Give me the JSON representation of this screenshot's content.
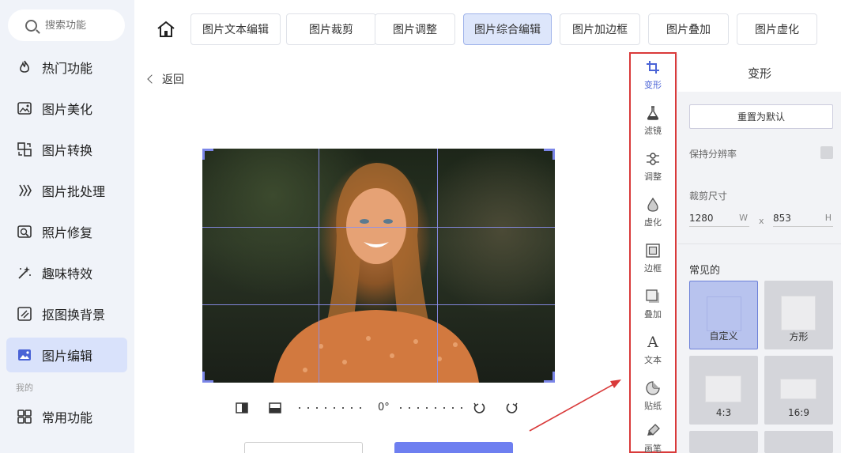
{
  "search": {
    "placeholder": "搜索功能",
    "icon": "search-icon"
  },
  "sidebar": {
    "items": [
      {
        "label": "热门功能",
        "icon": "fire-icon"
      },
      {
        "label": "图片美化",
        "icon": "image-beautify-icon"
      },
      {
        "label": "图片转换",
        "icon": "convert-icon"
      },
      {
        "label": "图片批处理",
        "icon": "batch-icon"
      },
      {
        "label": "照片修复",
        "icon": "repair-icon"
      },
      {
        "label": "趣味特效",
        "icon": "magic-wand-icon"
      },
      {
        "label": "抠图换背景",
        "icon": "cutout-icon"
      },
      {
        "label": "图片编辑",
        "icon": "image-edit-icon",
        "active": true
      }
    ],
    "section_label": "我的",
    "my_items": [
      {
        "label": "常用功能",
        "icon": "grid-icon"
      }
    ]
  },
  "topbar": {
    "home_icon": "home-icon",
    "tabs": [
      {
        "label": "图片文本编辑"
      },
      {
        "label": "图片裁剪"
      },
      {
        "label": "图片调整"
      },
      {
        "label": "图片综合编辑",
        "active": true
      },
      {
        "label": "图片加边框"
      },
      {
        "label": "图片叠加"
      },
      {
        "label": "图片虚化"
      }
    ]
  },
  "main": {
    "back_label": "返回",
    "rotation_label": "0°"
  },
  "rail": {
    "items": [
      {
        "label": "变形",
        "icon": "crop-icon",
        "active": true
      },
      {
        "label": "滤镜",
        "icon": "flask-icon"
      },
      {
        "label": "调整",
        "icon": "adjust-icon"
      },
      {
        "label": "虚化",
        "icon": "drop-icon"
      },
      {
        "label": "边框",
        "icon": "frame-icon"
      },
      {
        "label": "叠加",
        "icon": "overlay-icon"
      },
      {
        "label": "文本",
        "icon": "text-icon"
      },
      {
        "label": "贴纸",
        "icon": "sticker-icon"
      },
      {
        "label": "画笔",
        "icon": "brush-icon"
      }
    ]
  },
  "panel": {
    "title": "变形",
    "reset_label": "重置为默认",
    "keep_resolution_label": "保持分辨率",
    "crop_size_label": "裁剪尺寸",
    "width_value": "1280",
    "width_unit": "W",
    "times": "x",
    "height_value": "853",
    "height_unit": "H",
    "common_label": "常见的",
    "presets": [
      {
        "label": "自定义",
        "active": true
      },
      {
        "label": "方形"
      },
      {
        "label": "4:3"
      },
      {
        "label": "16:9"
      }
    ]
  },
  "colors": {
    "accent": "#4a63d6",
    "annotation_red": "#d93a3a",
    "active_nav_bg": "#d9e2fb"
  }
}
